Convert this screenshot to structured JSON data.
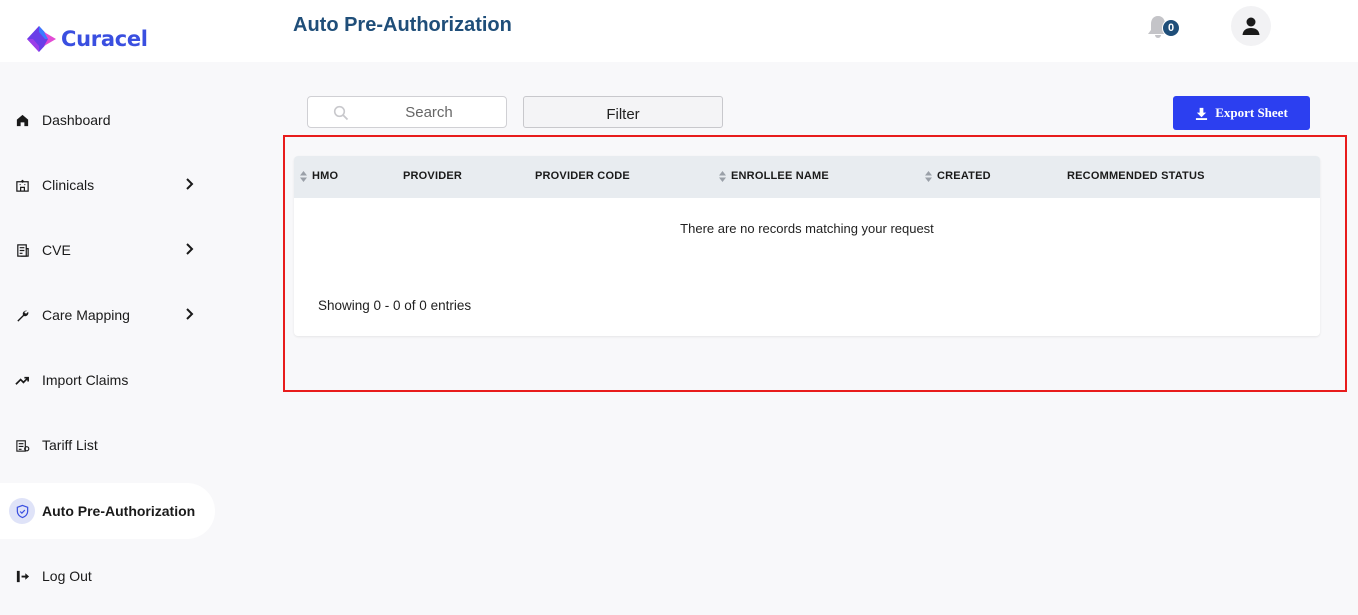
{
  "brand": {
    "name": "Curacel"
  },
  "header": {
    "title": "Auto Pre-Authorization",
    "notification_count": "0"
  },
  "sidebar": {
    "items": [
      {
        "label": "Dashboard",
        "icon": "home-icon"
      },
      {
        "label": "Clinicals",
        "icon": "hospital-icon"
      },
      {
        "label": "CVE",
        "icon": "document-icon"
      },
      {
        "label": "Care Mapping",
        "icon": "wrench-icon"
      },
      {
        "label": "Import Claims",
        "icon": "trend-up-icon"
      },
      {
        "label": "Tariff List",
        "icon": "list-icon"
      },
      {
        "label": "Auto Pre-Authorization",
        "icon": "shield-icon"
      },
      {
        "label": "Log Out",
        "icon": "logout-icon"
      }
    ]
  },
  "toolbar": {
    "search_placeholder": "Search",
    "filter_label": "Filter",
    "export_label": "Export Sheet"
  },
  "table": {
    "columns": [
      "HMO",
      "PROVIDER",
      "PROVIDER CODE",
      "ENROLLEE NAME",
      "CREATED",
      "RECOMMENDED STATUS"
    ],
    "empty_message": "There are no records matching your request",
    "entries_text": "Showing 0 - 0 of 0 entries"
  },
  "colors": {
    "primary": "#2c3ff0",
    "title": "#1f4e79",
    "highlight": "#e81c1c"
  }
}
